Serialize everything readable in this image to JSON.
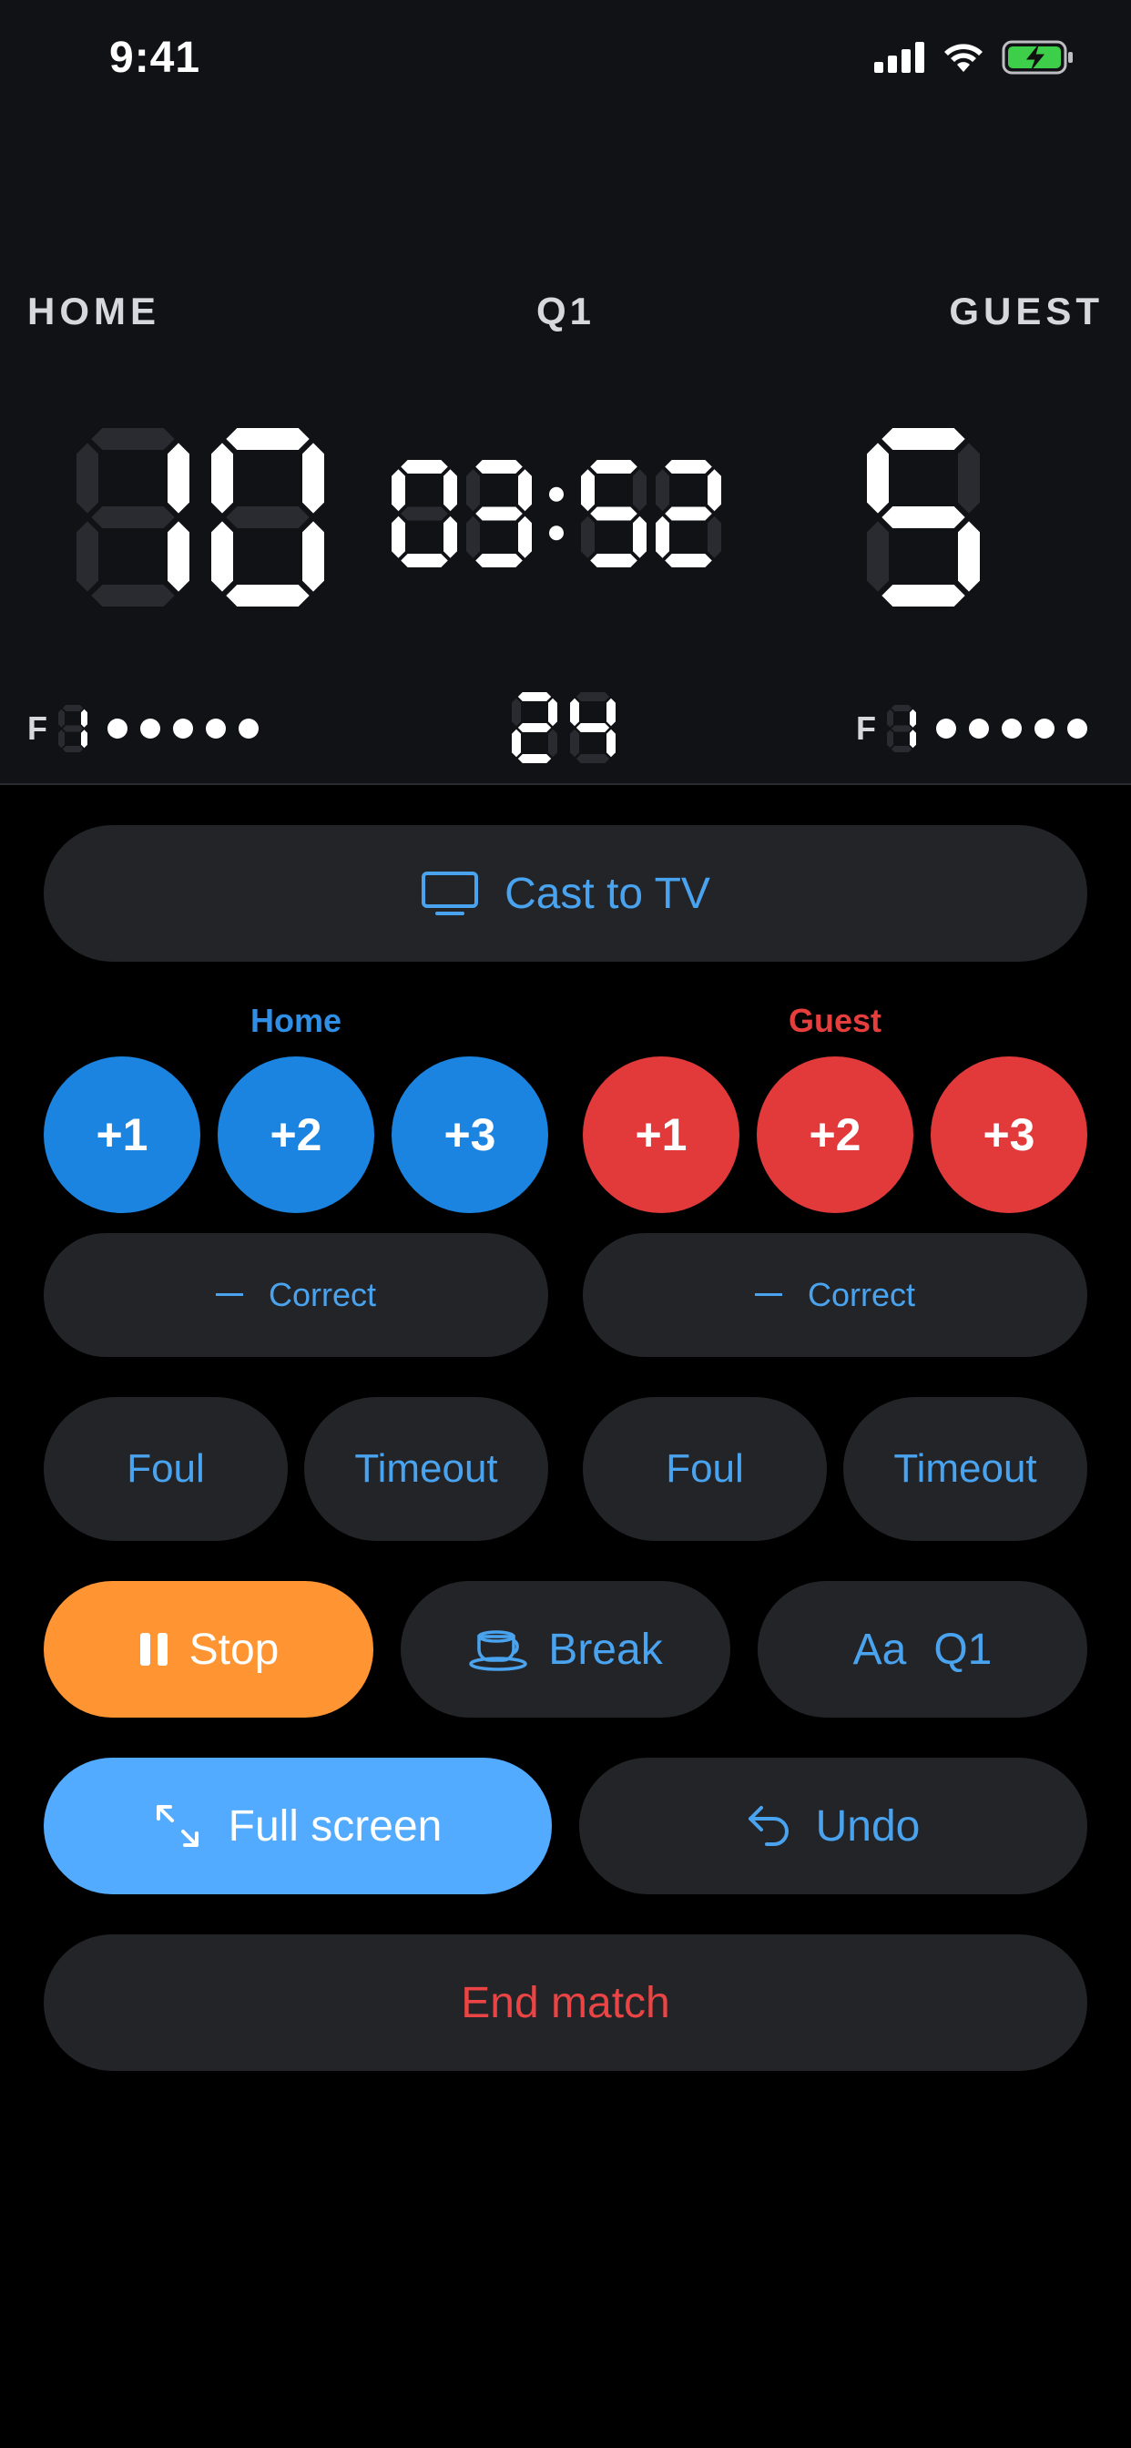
{
  "status_bar": {
    "time": "9:41",
    "icons": [
      "signal-icon",
      "wifi-icon",
      "battery-charging-icon"
    ]
  },
  "scoreboard": {
    "home_label": "HOME",
    "guest_label": "GUEST",
    "period": "Q1",
    "home_score": "10",
    "guest_score": "5",
    "game_clock": "03:52",
    "shot_clock": "24",
    "home_fouls": {
      "label": "F",
      "count": "1",
      "dots": 5
    },
    "guest_fouls": {
      "label": "F",
      "count": "1",
      "dots": 5
    }
  },
  "controls": {
    "cast_label": "Cast to TV",
    "home_section": "Home",
    "guest_section": "Guest",
    "home_points": [
      "+1",
      "+2",
      "+3"
    ],
    "guest_points": [
      "+1",
      "+2",
      "+3"
    ],
    "correct_label": "Correct",
    "foul_label": "Foul",
    "timeout_label": "Timeout",
    "stop_label": "Stop",
    "break_label": "Break",
    "font_label": "Aa",
    "period_label": "Q1",
    "fullscreen_label": "Full screen",
    "undo_label": "Undo",
    "end_match_label": "End match"
  },
  "colors": {
    "home": "#1b84e0",
    "guest": "#e23a3a",
    "accent_text": "#4aa3ef",
    "stop": "#ff9433",
    "fullscreen": "#52abff",
    "button_bg": "#232427",
    "end_match_text": "#ea4444"
  }
}
